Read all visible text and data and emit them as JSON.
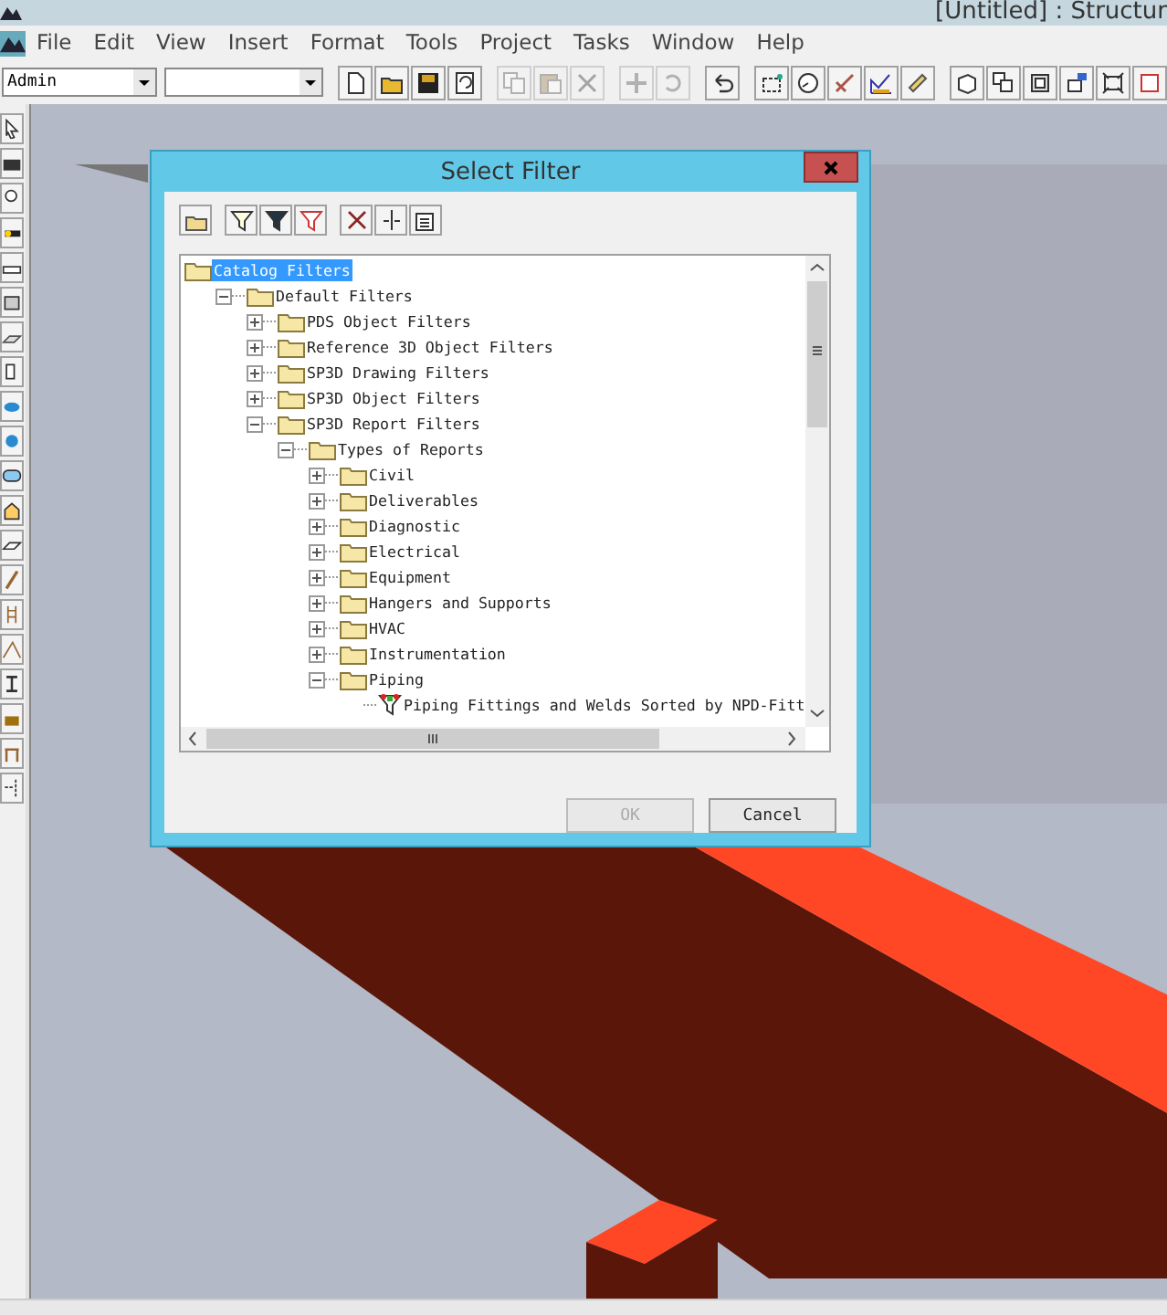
{
  "app_title": "[Untitled] : Structur",
  "menu": [
    "File",
    "Edit",
    "View",
    "Insert",
    "Format",
    "Tools",
    "Project",
    "Tasks",
    "Window",
    "Help"
  ],
  "combo_value": "Admin",
  "toolbar_groups": [
    [
      {
        "disabled": false
      },
      {
        "disabled": false
      },
      {
        "disabled": false
      },
      {
        "disabled": false
      }
    ],
    [
      {
        "disabled": true
      },
      {
        "disabled": true
      },
      {
        "disabled": true
      }
    ],
    [
      {
        "disabled": true
      },
      {
        "disabled": true
      }
    ],
    [
      {
        "disabled": false
      }
    ],
    [
      {
        "disabled": false
      },
      {
        "disabled": false
      },
      {
        "disabled": false
      },
      {
        "disabled": false
      },
      {
        "disabled": false
      }
    ],
    [
      {
        "disabled": false
      },
      {
        "disabled": false
      },
      {
        "disabled": false
      },
      {
        "disabled": false
      },
      {
        "disabled": false
      },
      {
        "disabled": false
      }
    ]
  ],
  "dialog": {
    "title": "Select Filter",
    "tree": [
      {
        "label": "Catalog Filters",
        "kind": "folder",
        "selected": true,
        "children": [
          {
            "label": "Default Filters",
            "kind": "folder",
            "selected": false,
            "expanded": true,
            "children": [
              {
                "label": "PDS Object Filters",
                "kind": "folder",
                "selected": false,
                "expanded": false
              },
              {
                "label": "Reference 3D Object Filters",
                "kind": "folder",
                "selected": false,
                "expanded": false
              },
              {
                "label": "SP3D Drawing Filters",
                "kind": "folder",
                "selected": false,
                "expanded": false
              },
              {
                "label": "SP3D Object Filters",
                "kind": "folder",
                "selected": false,
                "expanded": false
              },
              {
                "label": "SP3D Report Filters",
                "kind": "folder",
                "selected": false,
                "expanded": true,
                "children": [
                  {
                    "label": "Types of Reports",
                    "kind": "folder",
                    "selected": false,
                    "expanded": true,
                    "children": [
                      {
                        "label": "Civil",
                        "kind": "folder",
                        "selected": false,
                        "expanded": false
                      },
                      {
                        "label": "Deliverables",
                        "kind": "folder",
                        "selected": false,
                        "expanded": false
                      },
                      {
                        "label": "Diagnostic",
                        "kind": "folder",
                        "selected": false,
                        "expanded": false
                      },
                      {
                        "label": "Electrical",
                        "kind": "folder",
                        "selected": false,
                        "expanded": false
                      },
                      {
                        "label": "Equipment",
                        "kind": "folder",
                        "selected": false,
                        "expanded": false
                      },
                      {
                        "label": "Hangers and Supports",
                        "kind": "folder",
                        "selected": false,
                        "expanded": false
                      },
                      {
                        "label": "HVAC",
                        "kind": "folder",
                        "selected": false,
                        "expanded": false
                      },
                      {
                        "label": "Instrumentation",
                        "kind": "folder",
                        "selected": false,
                        "expanded": false
                      },
                      {
                        "label": "Piping",
                        "kind": "folder",
                        "selected": false,
                        "expanded": true,
                        "children": [
                          {
                            "label": "Piping Fittings and Welds Sorted by NPD-Fitt",
                            "kind": "filter",
                            "selected": false
                          }
                        ]
                      }
                    ]
                  }
                ]
              }
            ]
          }
        ]
      }
    ],
    "buttons": [
      {
        "label": "OK",
        "disabled": true
      },
      {
        "label": "Cancel",
        "disabled": false
      }
    ]
  }
}
